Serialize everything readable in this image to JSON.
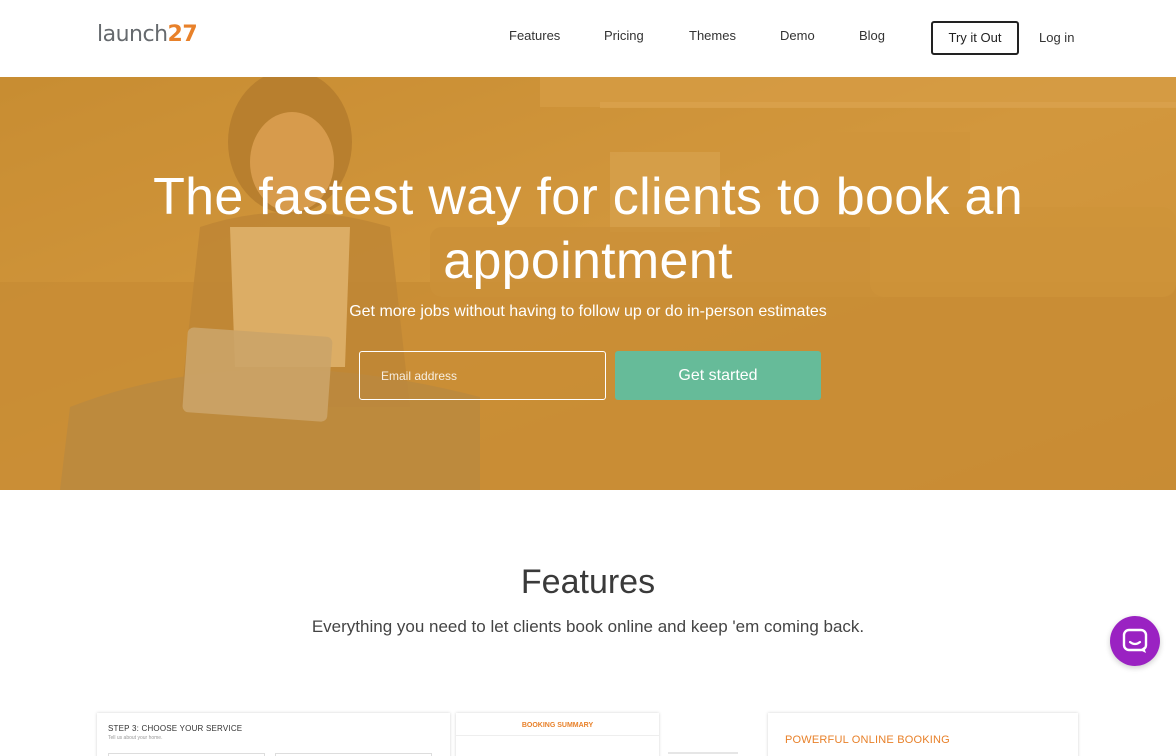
{
  "header": {
    "logo_word": "launch",
    "logo_number": "27",
    "nav": [
      {
        "label": "Features"
      },
      {
        "label": "Pricing"
      },
      {
        "label": "Themes"
      },
      {
        "label": "Demo"
      },
      {
        "label": "Blog"
      }
    ],
    "try_label": "Try it Out",
    "login_label": "Log in"
  },
  "hero": {
    "title_line1": "The fastest way for clients to book an",
    "title_line2": "appointment",
    "subtitle": "Get more jobs without having to follow up or do in-person estimates",
    "email_placeholder": "Email address",
    "cta_label": "Get started"
  },
  "features": {
    "title": "Features",
    "subtitle": "Everything you need to let clients book online and keep 'em coming back."
  },
  "previews": {
    "step_title": "STEP 3: CHOOSE YOUR SERVICE",
    "step_sub": "Tell us about your home.",
    "summary_title": "BOOKING SUMMARY",
    "feature_heading": "POWERFUL ONLINE BOOKING"
  },
  "colors": {
    "brand_orange": "#e8812a",
    "cta_green": "#66bb99",
    "chat_purple": "#9a22c2"
  },
  "icons": {
    "chat": "chat-bubble-icon"
  }
}
